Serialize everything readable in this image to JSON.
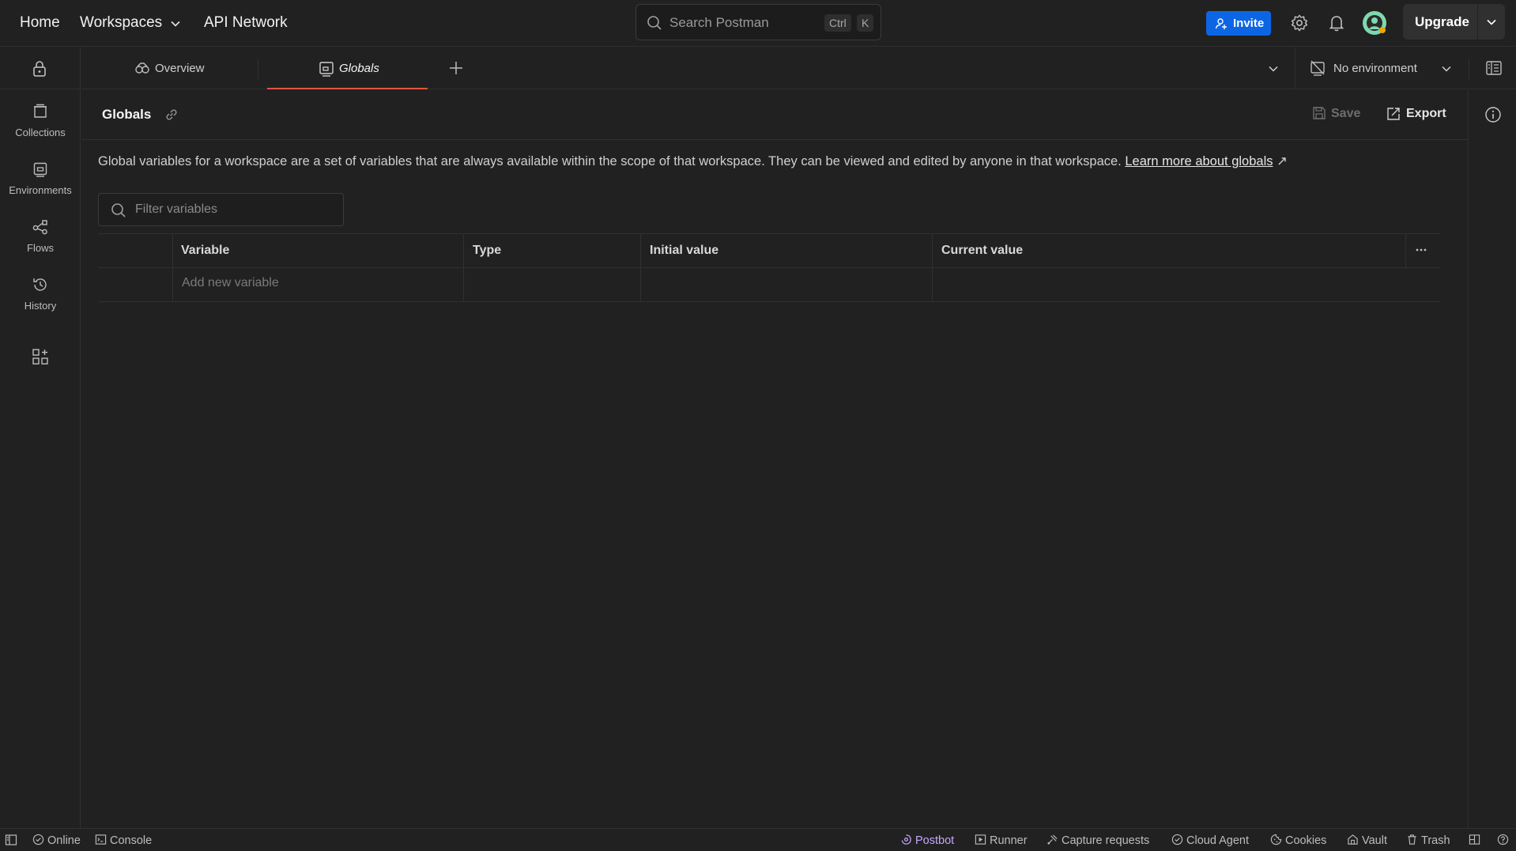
{
  "topbar": {
    "nav": [
      "Home",
      "Workspaces",
      "API Network"
    ],
    "search_placeholder": "Search Postman",
    "search_shortcut": [
      "Ctrl",
      "K"
    ],
    "invite_label": "Invite",
    "upgrade_label": "Upgrade"
  },
  "sidebar": {
    "items": [
      {
        "label": "Collections",
        "icon": "collections-icon"
      },
      {
        "label": "Environments",
        "icon": "environments-icon"
      },
      {
        "label": "Flows",
        "icon": "flows-icon"
      },
      {
        "label": "History",
        "icon": "history-icon"
      }
    ]
  },
  "tabs": [
    {
      "label": "Overview",
      "active": false
    },
    {
      "label": "Globals",
      "active": true
    }
  ],
  "environment_selector": {
    "value": "No environment"
  },
  "page": {
    "title": "Globals",
    "save_label": "Save",
    "export_label": "Export",
    "description": "Global variables for a workspace are a set of variables that are always available within the scope of that workspace. They can be viewed and edited by anyone in that workspace.",
    "learn_more": "Learn more about globals",
    "filter_placeholder": "Filter variables",
    "table": {
      "columns": [
        "Variable",
        "Type",
        "Initial value",
        "Current value"
      ],
      "add_placeholder": "Add new variable"
    }
  },
  "statusbar": {
    "left": [
      "Online",
      "Console"
    ],
    "right": [
      "Postbot",
      "Runner",
      "Capture requests",
      "Cloud Agent",
      "Cookies",
      "Vault",
      "Trash"
    ]
  },
  "colors": {
    "accent": "#0c66e4",
    "active_tab": "#e0553b",
    "postbot": "#c6a7ff",
    "background": "#212121"
  }
}
